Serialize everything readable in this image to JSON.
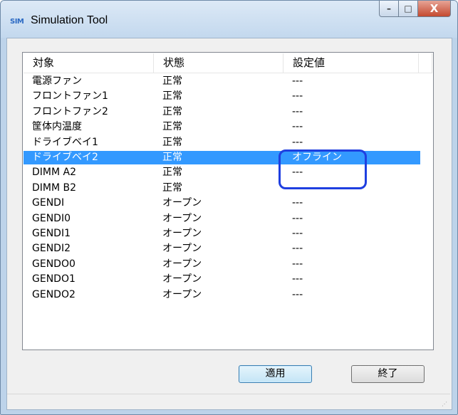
{
  "window": {
    "title": "Simulation Tool",
    "icon_text": "SIM"
  },
  "caption_buttons": {
    "minimize": "–",
    "maximize": "□",
    "close": "X"
  },
  "table": {
    "columns": [
      "対象",
      "状態",
      "設定値"
    ],
    "rows": [
      [
        "電源ファン",
        "正常",
        "---"
      ],
      [
        "フロントファン1",
        "正常",
        "---"
      ],
      [
        "フロントファン2",
        "正常",
        "---"
      ],
      [
        "筐体内温度",
        "正常",
        "---"
      ],
      [
        "ドライブベイ1",
        "正常",
        "---"
      ],
      [
        "ドライブベイ2",
        "正常",
        "オフライン"
      ],
      [
        "DIMM A2",
        "正常",
        "---"
      ],
      [
        "DIMM B2",
        "正常",
        "---"
      ],
      [
        "GENDI",
        "オープン",
        "---"
      ],
      [
        "GENDI0",
        "オープン",
        "---"
      ],
      [
        "GENDI1",
        "オープン",
        "---"
      ],
      [
        "GENDI2",
        "オープン",
        "---"
      ],
      [
        "GENDO0",
        "オープン",
        "---"
      ],
      [
        "GENDO1",
        "オープン",
        "---"
      ],
      [
        "GENDO2",
        "オープン",
        "---"
      ]
    ],
    "selected_row": 5
  },
  "buttons": {
    "apply": "適用",
    "exit": "終了"
  },
  "colors": {
    "selection": "#3399ff",
    "annotation": "#1f3fe0"
  }
}
